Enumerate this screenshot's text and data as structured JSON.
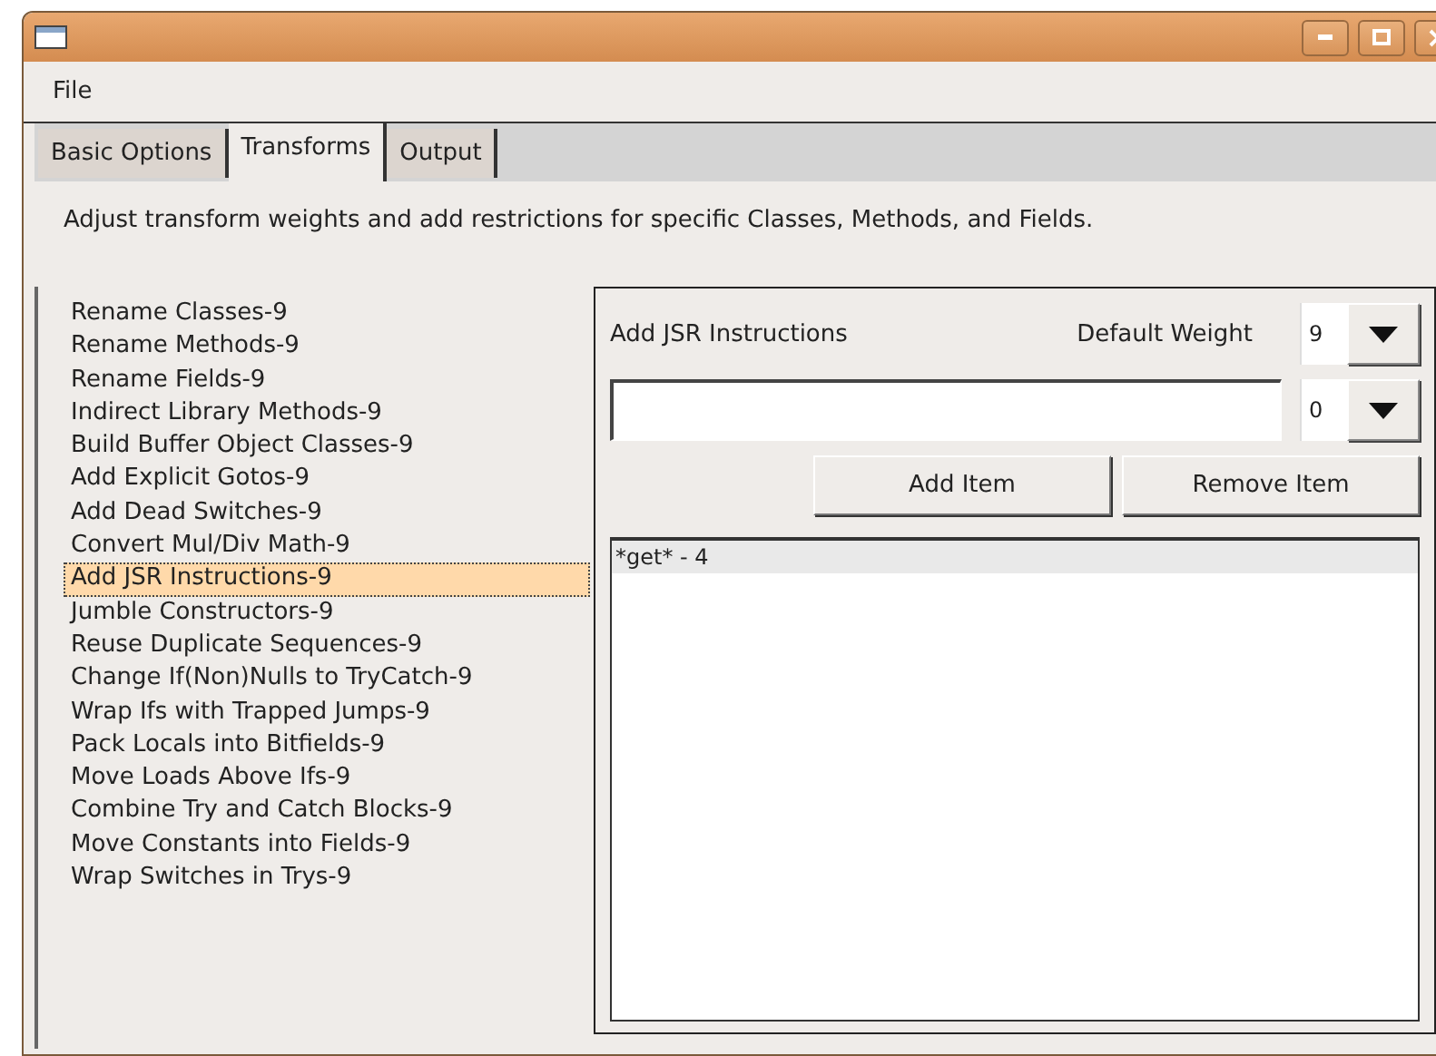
{
  "menu": [
    "File"
  ],
  "tabs": [
    {
      "label": "Basic Options",
      "selected": false
    },
    {
      "label": "Transforms",
      "selected": true
    },
    {
      "label": "Output",
      "selected": false
    }
  ],
  "description": "Adjust transform weights and add restrictions for specific Classes, Methods, and Fields.",
  "transforms": [
    {
      "label": "Rename Classes-9",
      "selected": false
    },
    {
      "label": "Rename Methods-9",
      "selected": false
    },
    {
      "label": "Rename Fields-9",
      "selected": false
    },
    {
      "label": "Indirect Library Methods-9",
      "selected": false
    },
    {
      "label": "Build Buffer Object Classes-9",
      "selected": false
    },
    {
      "label": "Add Explicit Gotos-9",
      "selected": false
    },
    {
      "label": "Add Dead Switches-9",
      "selected": false
    },
    {
      "label": "Convert Mul/Div Math-9",
      "selected": false
    },
    {
      "label": "Add JSR Instructions-9",
      "selected": true
    },
    {
      "label": "Jumble Constructors-9",
      "selected": false
    },
    {
      "label": "Reuse Duplicate Sequences-9",
      "selected": false
    },
    {
      "label": "Change If(Non)Nulls to TryCatch-9",
      "selected": false
    },
    {
      "label": "Wrap Ifs with Trapped Jumps-9",
      "selected": false
    },
    {
      "label": "Pack Locals into Bitfields-9",
      "selected": false
    },
    {
      "label": "Move Loads Above Ifs-9",
      "selected": false
    },
    {
      "label": "Combine Try and Catch Blocks-9",
      "selected": false
    },
    {
      "label": "Move Constants into Fields-9",
      "selected": false
    },
    {
      "label": "Wrap Switches in Trys-9",
      "selected": false
    }
  ],
  "detail": {
    "title": "Add JSR Instructions",
    "weight_label": "Default Weight",
    "weight": "9",
    "pattern_weight": "0",
    "buttons": [
      "Add Item",
      "Remove Item"
    ],
    "items": [
      "*get* - 4"
    ]
  }
}
